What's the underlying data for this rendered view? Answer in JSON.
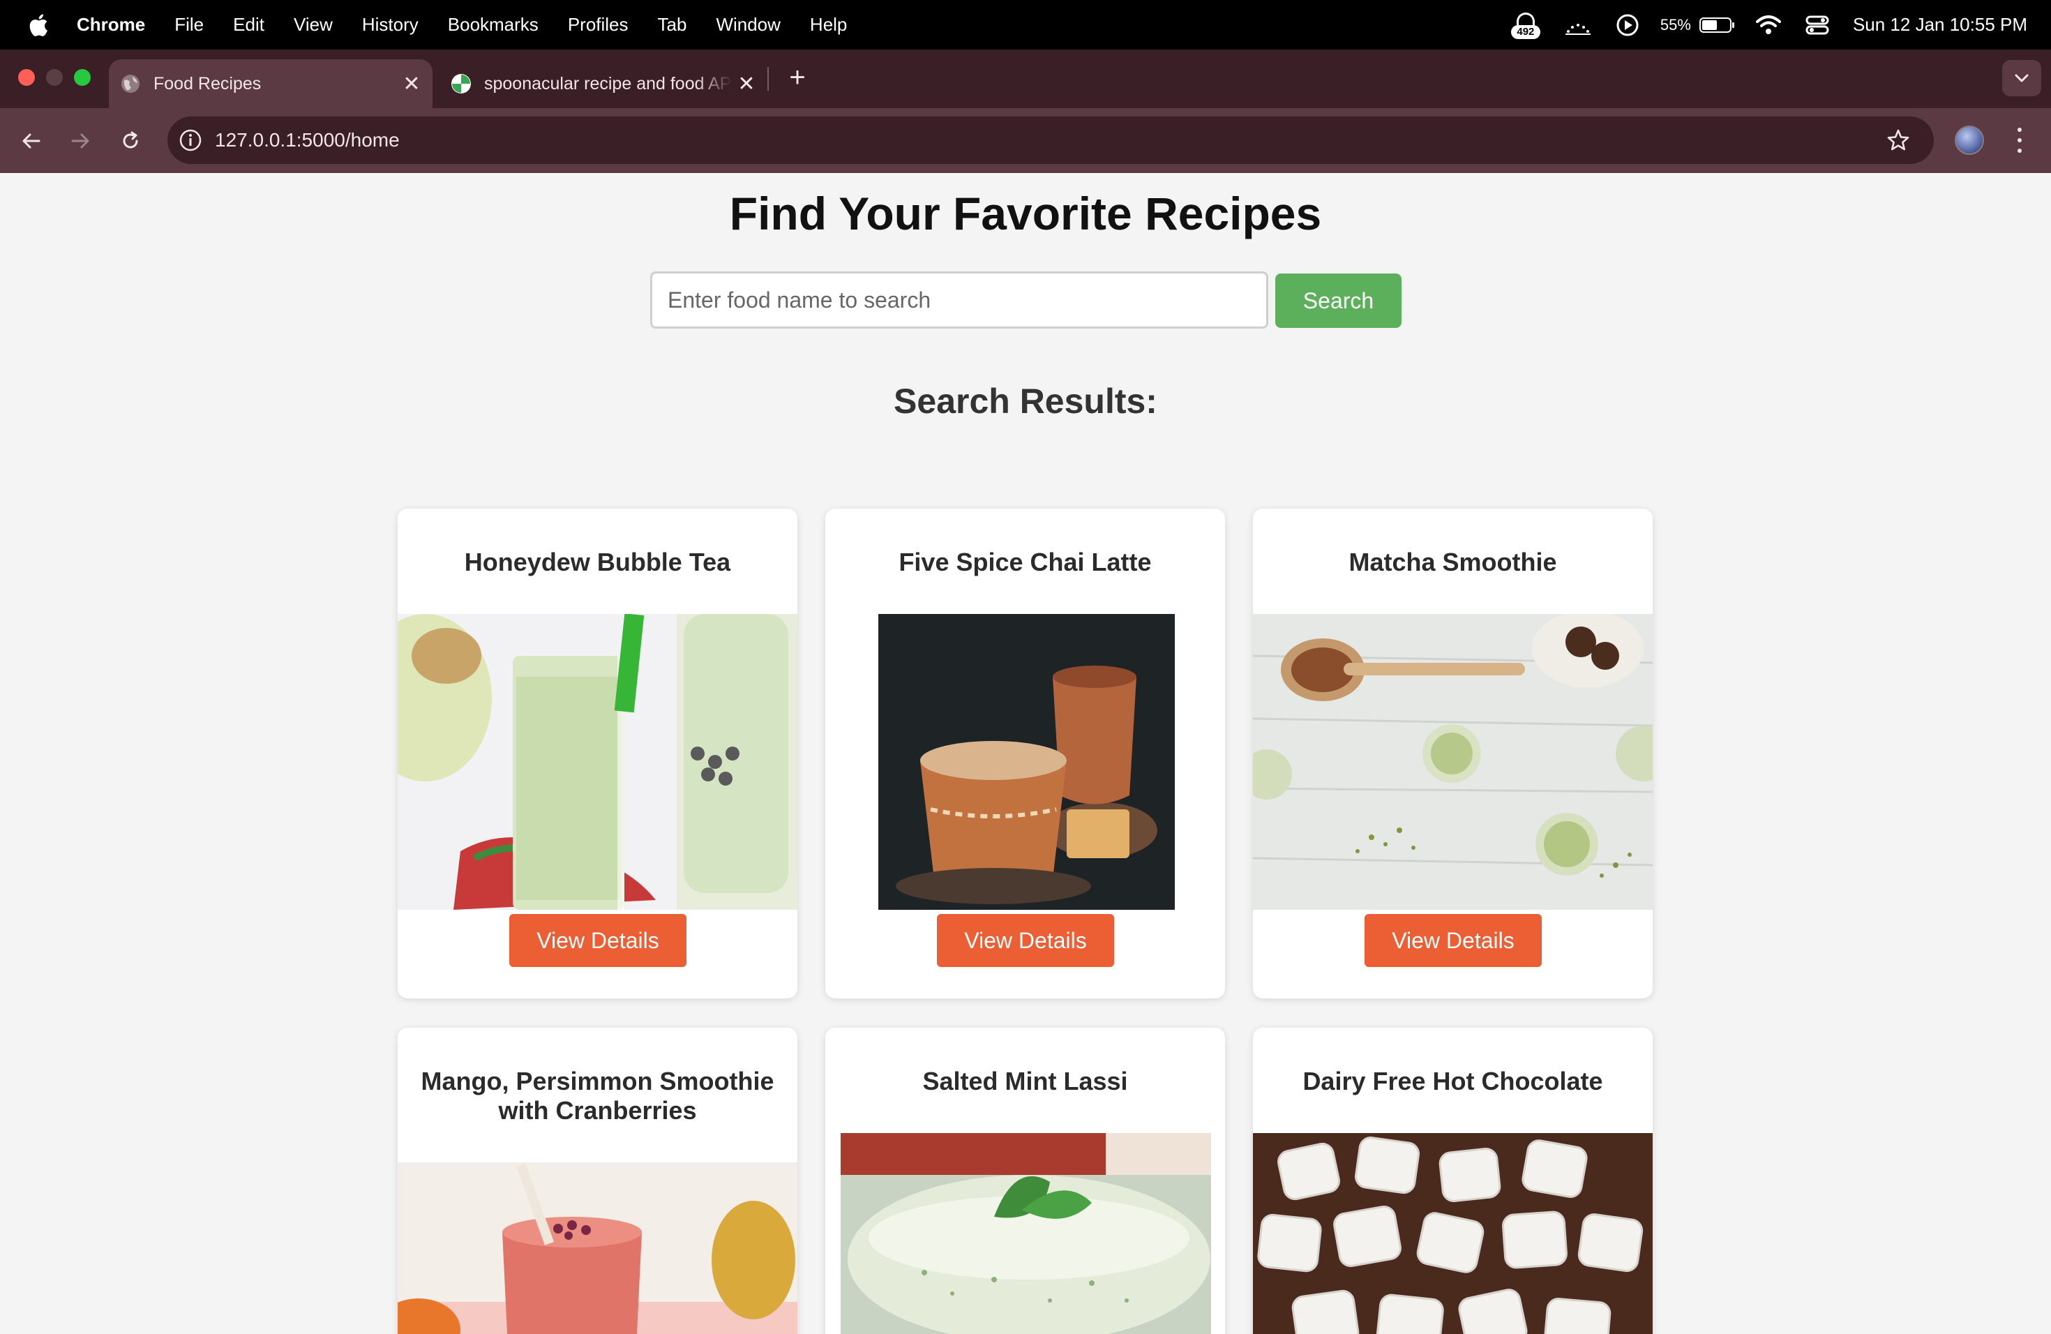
{
  "menubar": {
    "app": "Chrome",
    "items": [
      "File",
      "Edit",
      "View",
      "History",
      "Bookmarks",
      "Profiles",
      "Tab",
      "Window",
      "Help"
    ],
    "notification_count": "492",
    "battery_percent": "55%",
    "battery_level": 0.55,
    "clock": "Sun 12 Jan  10:55 PM"
  },
  "browser": {
    "tabs": [
      {
        "title": "Food Recipes",
        "active": true
      },
      {
        "title": "spoonacular recipe and food API",
        "active": false
      }
    ],
    "url": "127.0.0.1:5000/home"
  },
  "page": {
    "title": "Find Your Favorite Recipes",
    "search": {
      "placeholder": "Enter food name to search",
      "value": "",
      "button_label": "Search"
    },
    "results_heading": "Search Results:",
    "view_details_label": "View Details",
    "recipes": [
      {
        "title": "Honeydew Bubble Tea",
        "image": "honeydew-bubble-tea-photo"
      },
      {
        "title": "Five Spice Chai Latte",
        "image": "five-spice-chai-latte-photo"
      },
      {
        "title": "Matcha Smoothie",
        "image": "matcha-smoothie-photo"
      },
      {
        "title": "Mango, Persimmon Smoothie with Cranberries",
        "image": "mango-persimmon-smoothie-photo"
      },
      {
        "title": "Salted Mint Lassi",
        "image": "salted-mint-lassi-photo"
      },
      {
        "title": "Dairy Free Hot Chocolate",
        "image": "dairy-free-hot-chocolate-photo"
      }
    ]
  },
  "colors": {
    "accent_green": "#5cb05c",
    "button_orange": "#ec5e34",
    "chrome_frame": "#3a1f26",
    "chrome_toolbar": "#5b3a43"
  }
}
